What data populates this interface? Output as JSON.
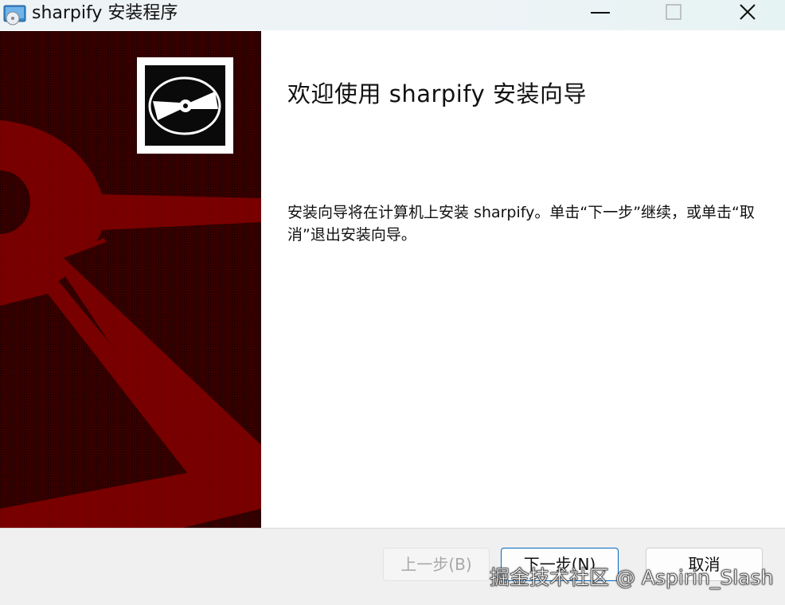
{
  "window": {
    "title": "sharpify 安装程序",
    "controls": [
      "minimize-icon",
      "maximize-icon",
      "close-icon"
    ]
  },
  "banner": {
    "logo_icon": "cd-disc-icon",
    "colors": {
      "dark": "#2a0000",
      "red": "#7a0000"
    }
  },
  "content": {
    "heading": "欢迎使用 sharpify 安装向导",
    "description": "安装向导将在计算机上安装 sharpify。单击“下一步”继续，或单击“取消”退出安装向导。"
  },
  "footer": {
    "back_label": "上一步(B)",
    "next_label": "下一步(N)",
    "cancel_label": "取消"
  },
  "watermark": "掘金技术社区 @ Aspirin_Slash"
}
